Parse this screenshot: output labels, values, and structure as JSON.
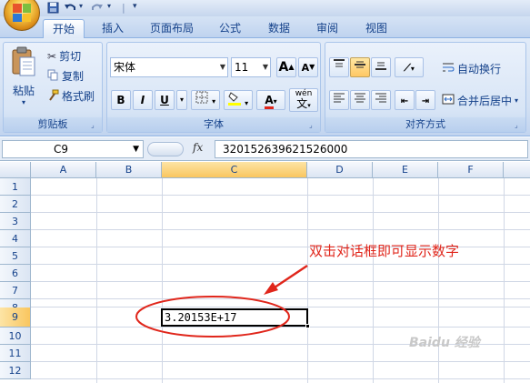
{
  "quick_access": {
    "save_icon": "save-icon",
    "undo_icon": "undo-icon",
    "redo_icon": "redo-icon"
  },
  "tabs": [
    {
      "label": "开始",
      "active": true
    },
    {
      "label": "插入"
    },
    {
      "label": "页面布局"
    },
    {
      "label": "公式"
    },
    {
      "label": "数据"
    },
    {
      "label": "审阅"
    },
    {
      "label": "视图"
    }
  ],
  "clipboard": {
    "paste": "粘贴",
    "cut": "剪切",
    "copy": "复制",
    "format_painter": "格式刷",
    "label": "剪贴板"
  },
  "font": {
    "name": "宋体",
    "size": "11",
    "grow": "A",
    "shrink": "A",
    "bold": "B",
    "italic": "I",
    "underline": "U",
    "wen": "wén",
    "wen_char": "文",
    "label": "字体"
  },
  "alignment": {
    "wrap": "自动换行",
    "merge": "合并后居中",
    "label": "对齐方式"
  },
  "formula_bar": {
    "name_box": "C9",
    "fx": "fx",
    "formula": "320152639621526000"
  },
  "columns": [
    "A",
    "B",
    "C",
    "D",
    "E",
    "F"
  ],
  "rows": [
    "1",
    "2",
    "3",
    "4",
    "5",
    "6",
    "7",
    "8",
    "9",
    "10",
    "11",
    "12"
  ],
  "selected": {
    "column": "C",
    "row": "9"
  },
  "cell_c9": "3.20153E+17",
  "annotation": "双击对话框即可显示数字",
  "watermark": "Baidu 经验",
  "colors": {
    "accent": "#15428b",
    "annotation_red": "#e0261b",
    "selection_orange": "#f9c65f"
  }
}
